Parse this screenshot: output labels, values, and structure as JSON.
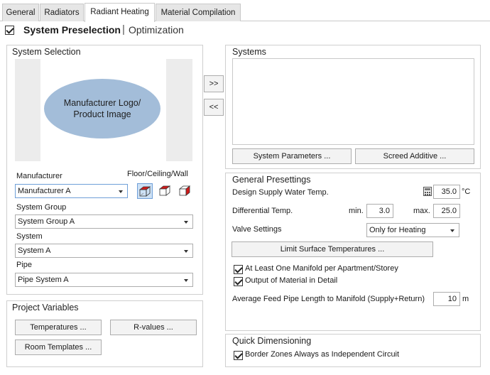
{
  "tabs": [
    {
      "label": "General"
    },
    {
      "label": "Radiators"
    },
    {
      "label": "Radiant Heating"
    },
    {
      "label": "Material Compilation"
    }
  ],
  "mode": {
    "checked": true,
    "primary_label": "System Preselection",
    "separator": "|",
    "secondary_label": "Optimization"
  },
  "system_selection": {
    "title": "System Selection",
    "logo_text": "Manufacturer Logo/\nProduct Image",
    "manufacturer_label": "Manufacturer",
    "manufacturer_value": "Manufacturer A",
    "orientation_label": "Floor/Ceiling/Wall",
    "system_group_label": "System Group",
    "system_group_value": "System Group A",
    "system_label": "System",
    "system_value": "System A",
    "pipe_label": "Pipe",
    "pipe_value": "Pipe System A"
  },
  "transfer": {
    "add_label": ">>",
    "remove_label": "<<"
  },
  "systems": {
    "title": "Systems",
    "params_button": "System Parameters ...",
    "screed_button": "Screed Additive ..."
  },
  "project_variables": {
    "title": "Project Variables",
    "temperatures_button": "Temperatures ...",
    "rvalues_button": "R-values ...",
    "room_templates_button": "Room Templates ..."
  },
  "general_presettings": {
    "title": "General Presettings",
    "design_supply_label": "Design Supply Water Temp.",
    "design_supply_value": "35.0",
    "design_supply_unit": "°C",
    "diff_temp_label": "Differential Temp.",
    "min_label": "min.",
    "min_value": "3.0",
    "max_label": "max.",
    "max_value": "25.0",
    "valve_label": "Valve Settings",
    "valve_value": "Only for Heating",
    "limit_button": "Limit Surface Temperatures ...",
    "manifold_check_label": "At Least One Manifold per Apartment/Storey",
    "manifold_checked": true,
    "output_check_label": "Output of Material in Detail",
    "output_checked": true,
    "feed_pipe_label": "Average Feed Pipe Length to Manifold (Supply+Return)",
    "feed_pipe_value": "10",
    "feed_pipe_unit": "m"
  },
  "quick_dimensioning": {
    "title": "Quick Dimensioning",
    "border_check_label": "Border Zones Always as Independent Circuit",
    "border_checked": true
  },
  "colors": {
    "logo_ellipse": "#a3bdd9",
    "logo_side_panel": "#ececec",
    "cube_red": "#d11a1a",
    "selected_icon_bg": "#cde1f5"
  },
  "icons": [
    "calculator-icon",
    "floor-cube-icon",
    "ceiling-cube-icon",
    "wall-cube-icon"
  ]
}
